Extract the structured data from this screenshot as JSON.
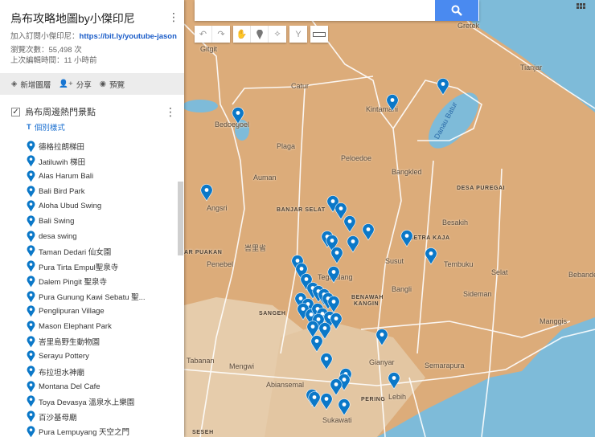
{
  "sidebar": {
    "title": "烏布攻略地圖by小傑印尼",
    "subscribe_label": "加入訂閱小傑印尼：",
    "subscribe_link": "https://bit.ly/youtube-jason",
    "views": "瀏覽次數：55,498 次",
    "last_edit": "上次編輯時間：11 小時前",
    "actions": {
      "add_layer": "新增圖層",
      "share": "分享",
      "preview": "預覽"
    },
    "layer": {
      "name": "烏布周邊熱門景點",
      "checked": true,
      "style_label": "個別樣式",
      "items": [
        "德格拉朗梯田",
        "Jatiluwih 梯田",
        "Alas Harum Bali",
        "Bali Bird Park",
        "Aloha Ubud Swing",
        "Bali Swing",
        "desa swing",
        "Taman Dedari 仙女園",
        "Pura Tirta Empul聖泉寺",
        "Dalem Pingit 聖泉寺",
        "Pura Gunung Kawi Sebatu 聖...",
        "Penglipuran Village",
        "Mason Elephant Park",
        "峇里島野生動物園",
        "Serayu Pottery",
        "布拉坦水神廟",
        "Montana Del Cafe",
        "Toya Devasya 溫泉水上樂園",
        "百沙基母廟",
        "Pura Lempuyang 天空之門"
      ]
    }
  },
  "map": {
    "search_placeholder": "",
    "labels": {
      "gitgit": "Gitgit",
      "gretek": "Gretek",
      "tianjar": "Tianjar",
      "catur": "Catur",
      "kintamani": "Kintamani",
      "bedugul": "Bedoegoel",
      "plaga": "Plaga",
      "peloedoe": "Peloedoe",
      "bangkled": "Bangkled",
      "auman": "Auman",
      "desa_puregai": "DESA PUREGAI",
      "angsri": "Angsri",
      "banjar_selat": "BANJAR SELAT",
      "besakih": "Besakih",
      "metra_kaja": "METRA KAJA",
      "province": "峇里省",
      "puakan": "AR PUAKAN",
      "penebel": "Penebel",
      "susut": "Susut",
      "tembuku": "Tembuku",
      "selat": "Selat",
      "bebandem": "Bebandem",
      "tegalalang": "Tegalalang",
      "bangli": "Bangli",
      "benawah": "BENAWAH",
      "kangin": "KANGIN",
      "sideman": "Sideman",
      "sangeh": "SANGEH",
      "manggis": "Manggis",
      "tabanan": "Tabanan",
      "mengwi": "Mengwi",
      "gianyar": "Gianyar",
      "semarapura": "Semarapura",
      "abiansemal": "Abiansemal",
      "pering": "PERING",
      "lebih": "Lebih",
      "sukawati": "Sukawati",
      "seseh": "SESEH",
      "danau_batur": "Danau Batur"
    }
  },
  "colors": {
    "land": "#dcac7a",
    "urban": "#e6ccab",
    "sea": "#7ebbd9",
    "pin": "#0b78c8",
    "link": "#1a5cc8",
    "search_button": "#4a8af0"
  }
}
